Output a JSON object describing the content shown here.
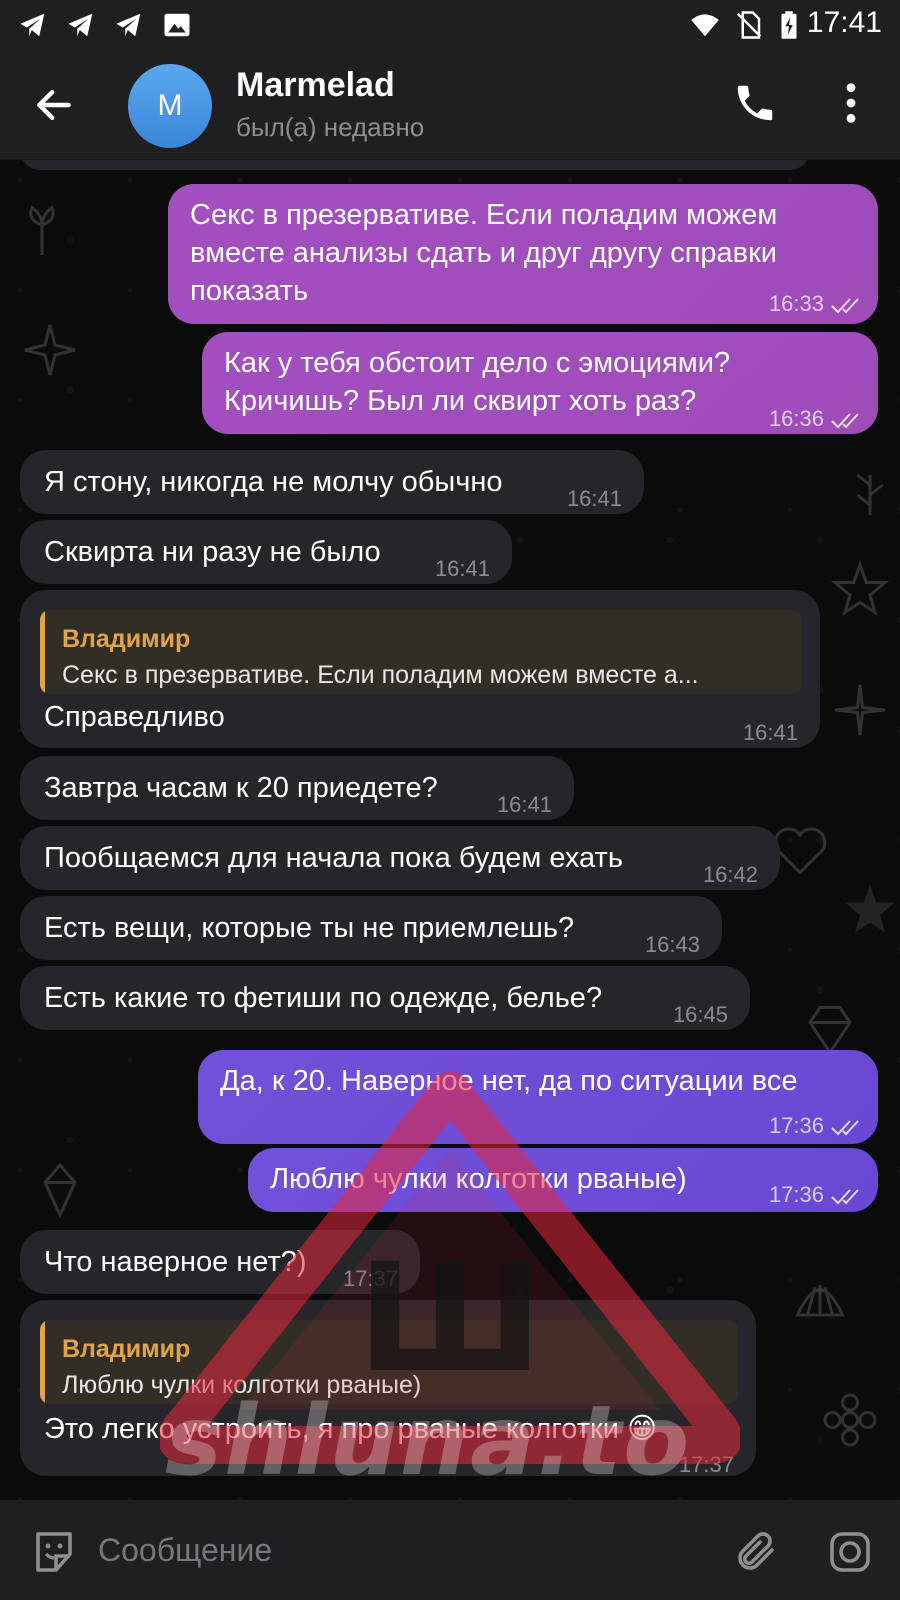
{
  "status_bar": {
    "time": "17:41",
    "left_icons": [
      "telegram-icon",
      "telegram-icon",
      "telegram-icon",
      "image-icon"
    ],
    "right_icons": [
      "wifi-icon",
      "no-sim-icon",
      "battery-charging-icon"
    ]
  },
  "header": {
    "avatar_letter": "M",
    "title": "Marmelad",
    "status": "был(а) недавно",
    "avatar_color": "#4a97e4"
  },
  "messages": [
    {
      "dir": "out",
      "text": "Секс в презервативе. Если поладим можем\nвместе анализы сдать и друг другу справки\nпоказать",
      "time": "16:33",
      "read": true
    },
    {
      "dir": "out",
      "text": "Как у тебя обстоит дело с эмоциями?\nКричишь? Был ли сквирт хоть раз?",
      "time": "16:36",
      "read": true
    },
    {
      "dir": "in",
      "text": "Я стону, никогда не молчу обычно",
      "time": "16:41"
    },
    {
      "dir": "in",
      "text": "Сквирта ни разу не было",
      "time": "16:41"
    },
    {
      "dir": "in",
      "text": "Справедливо",
      "time": "16:41",
      "reply": {
        "name": "Владимир",
        "text": "Секс в презервативе. Если поладим можем вместе а..."
      }
    },
    {
      "dir": "in",
      "text": "Завтра часам к 20 приедете?",
      "time": "16:41"
    },
    {
      "dir": "in",
      "text": "Пообщаемся для начала пока будем ехать",
      "time": "16:42"
    },
    {
      "dir": "in",
      "text": "Есть вещи, которые ты не приемлешь?",
      "time": "16:43"
    },
    {
      "dir": "in",
      "text": "Есть какие то фетиши по одежде, белье?",
      "time": "16:45"
    },
    {
      "dir": "out",
      "text": "Да, к 20. Наверное нет, да по ситуации все",
      "time": "17:36",
      "read": true
    },
    {
      "dir": "out",
      "text": "Люблю чулки колготки рваные)",
      "time": "17:36",
      "read": true
    },
    {
      "dir": "in",
      "text": "Что наверное нет?)",
      "time": "17:37"
    },
    {
      "dir": "in",
      "text": "Это легко устроить, я про рваные колготки 😁",
      "time": "17:37",
      "reply": {
        "name": "Владимир",
        "text": "Люблю чулки колготки рваные)"
      }
    }
  ],
  "watermark": {
    "text": "shluna.to",
    "letter": "Ш"
  },
  "input": {
    "placeholder": "Сообщение"
  },
  "colors": {
    "outgoing_pink": "#a24fc0",
    "outgoing_violet": "#7350d8",
    "incoming": "#26262a",
    "reply_accent": "#e3a449",
    "bar": "#1f1f22"
  }
}
